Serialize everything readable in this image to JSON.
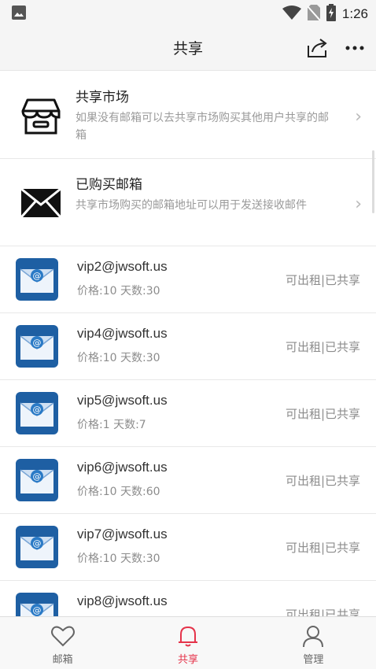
{
  "status_bar": {
    "time": "1:26",
    "icons": [
      "gallery-icon",
      "wifi-icon",
      "no-sim-icon",
      "battery-charging-icon"
    ]
  },
  "header": {
    "title": "共享",
    "actions": [
      "share-export-icon",
      "more-icon"
    ]
  },
  "features": [
    {
      "title": "共享市场",
      "desc": "如果没有邮箱可以去共享市场购买其他用户共享的邮箱",
      "icon": "store-icon"
    },
    {
      "title": "已购买邮箱",
      "desc": "共享市场购买的邮箱地址可以用于发送接收邮件",
      "icon": "envelope-icon"
    }
  ],
  "mailboxes": [
    {
      "address": "vip2@jwsoft.us",
      "meta": "价格:10 天数:30",
      "status": "可出租|已共享"
    },
    {
      "address": "vip4@jwsoft.us",
      "meta": "价格:10 天数:30",
      "status": "可出租|已共享"
    },
    {
      "address": "vip5@jwsoft.us",
      "meta": "价格:1 天数:7",
      "status": "可出租|已共享"
    },
    {
      "address": "vip6@jwsoft.us",
      "meta": "价格:10 天数:60",
      "status": "可出租|已共享"
    },
    {
      "address": "vip7@jwsoft.us",
      "meta": "价格:10 天数:30",
      "status": "可出租|已共享"
    },
    {
      "address": "vip8@jwsoft.us",
      "meta": "",
      "status": "可出租|已共享"
    }
  ],
  "bottom_nav": [
    {
      "label": "邮箱",
      "icon": "heart-icon",
      "active": false
    },
    {
      "label": "共享",
      "icon": "bell-icon",
      "active": true
    },
    {
      "label": "管理",
      "icon": "person-icon",
      "active": false
    }
  ],
  "colors": {
    "accent": "#e5334a",
    "header_bg": "#f5f5f5",
    "muted_text": "#8c8c8c"
  }
}
